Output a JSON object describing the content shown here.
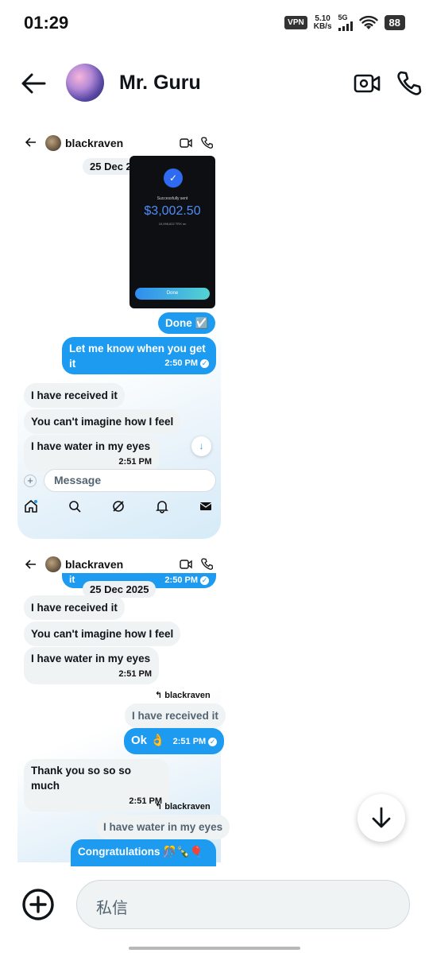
{
  "status_bar": {
    "time": "01:29",
    "vpn": "VPN",
    "speed_value": "5.10",
    "speed_unit": "KB/s",
    "network": "5G",
    "battery": "88"
  },
  "header": {
    "title": "Mr. Guru",
    "back_icon": "back-arrow-icon",
    "video_icon": "video-call-icon",
    "call_icon": "phone-icon"
  },
  "screenshot_1": {
    "contact": "blackraven",
    "date": "25 Dec 2025",
    "payment": {
      "status": "Successfully sent",
      "amount": "$3,002.50",
      "sub": "10,096,622 TRX on",
      "button": "Done"
    },
    "messages": [
      {
        "dir": "out",
        "text": "Done ☑️",
        "time": ""
      },
      {
        "dir": "out",
        "text": "Let me know when you get it",
        "time": "2:50 PM"
      },
      {
        "dir": "in",
        "text": "I have received it",
        "time": ""
      },
      {
        "dir": "in",
        "text": "You can't imagine  how I feel",
        "time": ""
      },
      {
        "dir": "in",
        "text": "I have water in my eyes",
        "time": "2:51 PM"
      }
    ],
    "composer_placeholder": "Message"
  },
  "screenshot_2": {
    "contact": "blackraven",
    "date": "25 Dec 2025",
    "partial_top": {
      "text": "it",
      "time": "2:50 PM"
    },
    "messages": [
      {
        "dir": "in",
        "text": "I have received it",
        "time": ""
      },
      {
        "dir": "in",
        "text": "You can't imagine  how I feel",
        "time": ""
      },
      {
        "dir": "in",
        "text": "I have water in my eyes",
        "time": "2:51 PM"
      }
    ]
  },
  "chat": {
    "reply_1": {
      "to": "blackraven",
      "quoted": "I have received it"
    },
    "ok_message": {
      "text": "Ok 👌",
      "time": "2:51 PM"
    },
    "thank_message": {
      "text": "Thank you so so so much",
      "time": "2:51 PM"
    },
    "reply_2": {
      "to": "blackraven",
      "quoted": "I have water in my eyes"
    },
    "congrats_message": {
      "text": "Congratulations 🎊🍾🎈"
    }
  },
  "composer": {
    "placeholder": "私信"
  },
  "colors": {
    "accent": "#1d9bf0",
    "incoming_bubble": "#eff3f4",
    "text": "#0f1419"
  }
}
